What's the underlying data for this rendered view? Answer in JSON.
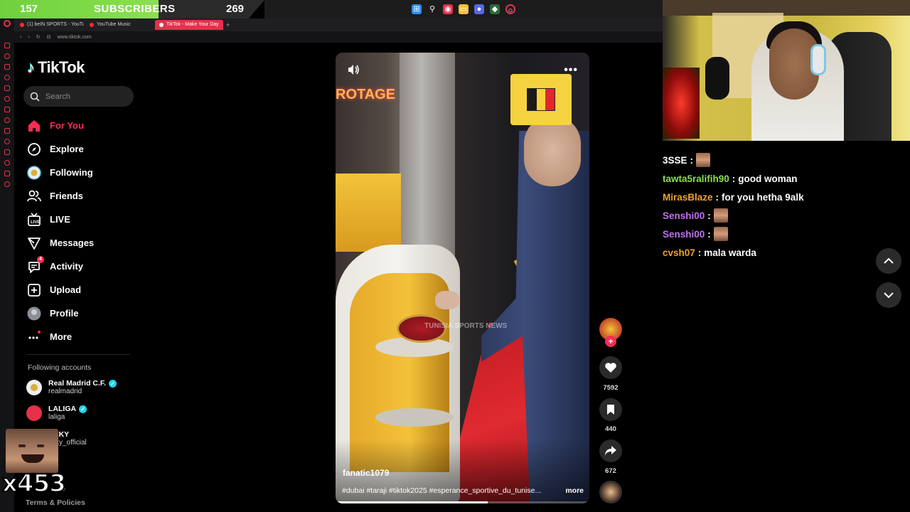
{
  "overlay": {
    "subscribers_current": "157",
    "subscribers_label": "SUBSCRIBERS",
    "subscribers_goal": "269",
    "emote_multiplier": "x453"
  },
  "browser": {
    "tabs": [
      {
        "label": "(1) beIN SPORTS - YouTube"
      },
      {
        "label": "YouTube Music"
      },
      {
        "label": "TikTok - Make Your Day"
      }
    ],
    "url": "www.tiktok.com"
  },
  "tiktok": {
    "logo_text": "TikTok",
    "search_placeholder": "Search",
    "nav": [
      {
        "label": "For You",
        "icon": "home-icon"
      },
      {
        "label": "Explore",
        "icon": "compass-icon"
      },
      {
        "label": "Following",
        "icon": "following-avatar"
      },
      {
        "label": "Friends",
        "icon": "friends-icon"
      },
      {
        "label": "LIVE",
        "icon": "live-icon"
      },
      {
        "label": "Messages",
        "icon": "messages-icon"
      },
      {
        "label": "Activity",
        "icon": "activity-icon",
        "badge": "4"
      },
      {
        "label": "Upload",
        "icon": "upload-icon"
      },
      {
        "label": "Profile",
        "icon": "profile-avatar"
      },
      {
        "label": "More",
        "icon": "more-dots-icon"
      }
    ],
    "following_title": "Following accounts",
    "accounts": [
      {
        "name": "Real Madrid C.F.",
        "handle": "realmadrid"
      },
      {
        "name": "LALIGA",
        "handle": "laliga"
      },
      {
        "name": "SKKY",
        "handle": "skky_official"
      }
    ],
    "footer_more": "ne",
    "terms": "Terms & Policies"
  },
  "video": {
    "username": "fanatic1079",
    "caption": "#dubai #taraji #tiktok2025 #esperance_sportive_du_tunise...",
    "more": "more",
    "watermark": "TUNISIA SPORTS NEWS",
    "sign_text": "ROTAGE",
    "progress": 0.6,
    "likes": "7592",
    "saves": "440",
    "shares": "672",
    "flag_colors": [
      "#1a1a1a",
      "#f5d340",
      "#e3262c"
    ]
  },
  "chat": [
    {
      "user": "3SSE",
      "color": "#ffffff",
      "text": "",
      "emote": true
    },
    {
      "user": "tawta5ralifih90",
      "color": "#8be04e",
      "text": "good woman",
      "emote": false
    },
    {
      "user": "MirasBlaze",
      "color": "#f0a030",
      "text": "for you hetha 9alk",
      "emote": false
    },
    {
      "user": "Senshi00",
      "color": "#c070f0",
      "text": "",
      "emote": true
    },
    {
      "user": "Senshi00",
      "color": "#c070f0",
      "text": "",
      "emote": true
    },
    {
      "user": "cvsh07",
      "color": "#f0a030",
      "text": "mala warda",
      "emote": false
    }
  ]
}
